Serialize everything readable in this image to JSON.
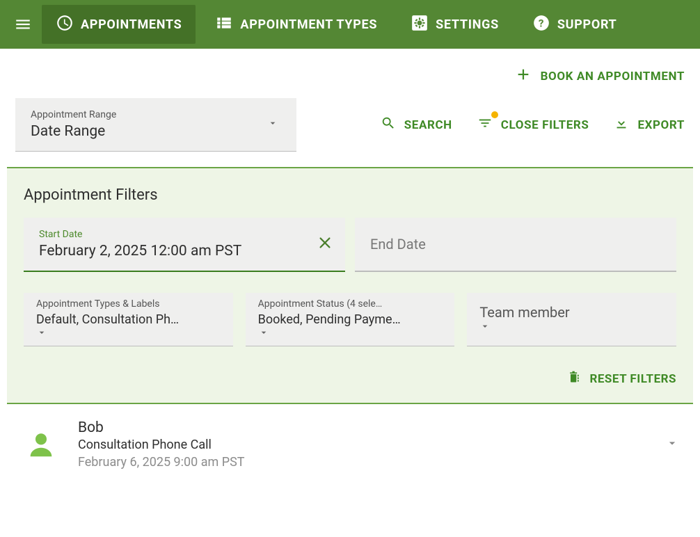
{
  "nav": {
    "appointments": "APPOINTMENTS",
    "appointment_types": "APPOINTMENT TYPES",
    "settings": "SETTINGS",
    "support": "SUPPORT"
  },
  "actions": {
    "book": "BOOK AN APPOINTMENT",
    "search": "SEARCH",
    "close_filters": "CLOSE FILTERS",
    "export": "EXPORT",
    "reset_filters": "RESET FILTERS"
  },
  "range": {
    "label": "Appointment Range",
    "value": "Date Range"
  },
  "filters": {
    "title": "Appointment Filters",
    "start_date_label": "Start Date",
    "start_date_value": "February 2, 2025 12:00 am PST",
    "end_date_label": "End Date",
    "types_label": "Appointment Types & Labels",
    "types_value": "Default, Consultation Ph…",
    "status_label": "Appointment Status (4 sele…",
    "status_value": "Booked, Pending Payme…",
    "team_placeholder": "Team member"
  },
  "appointments": [
    {
      "name": "Bob",
      "type": "Consultation Phone Call",
      "time": "February 6, 2025 9:00 am PST"
    }
  ]
}
